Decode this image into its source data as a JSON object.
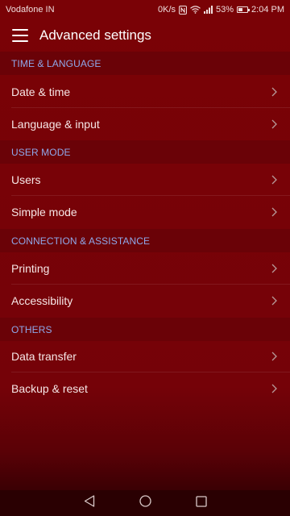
{
  "status_bar": {
    "carrier": "Vodafone IN",
    "speed": "0K/s",
    "battery_percent": "53%",
    "battery_level": 0.53,
    "time": "2:04 PM",
    "icons": [
      "nfc-icon",
      "wifi-icon",
      "signal-icon",
      "battery-icon"
    ]
  },
  "app_bar": {
    "title": "Advanced settings",
    "menu_icon": "hamburger-menu-icon"
  },
  "sections": [
    {
      "header": "TIME & LANGUAGE",
      "items": [
        {
          "label": "Date & time"
        },
        {
          "label": "Language & input"
        }
      ]
    },
    {
      "header": "USER MODE",
      "items": [
        {
          "label": "Users"
        },
        {
          "label": "Simple mode"
        }
      ]
    },
    {
      "header": "CONNECTION & ASSISTANCE",
      "items": [
        {
          "label": "Printing"
        },
        {
          "label": "Accessibility"
        }
      ]
    },
    {
      "header": "OTHERS",
      "items": [
        {
          "label": "Data transfer"
        },
        {
          "label": "Backup & reset"
        }
      ]
    }
  ],
  "nav_bar": {
    "buttons": [
      "back-icon",
      "home-icon",
      "recents-icon"
    ]
  },
  "colors": {
    "background": "#7a0206",
    "section_header_bg": "#6a0207",
    "section_header_text": "#8fa8ea",
    "item_text": "#f6e6e6",
    "nav_bar_bg": "#2a0002"
  }
}
